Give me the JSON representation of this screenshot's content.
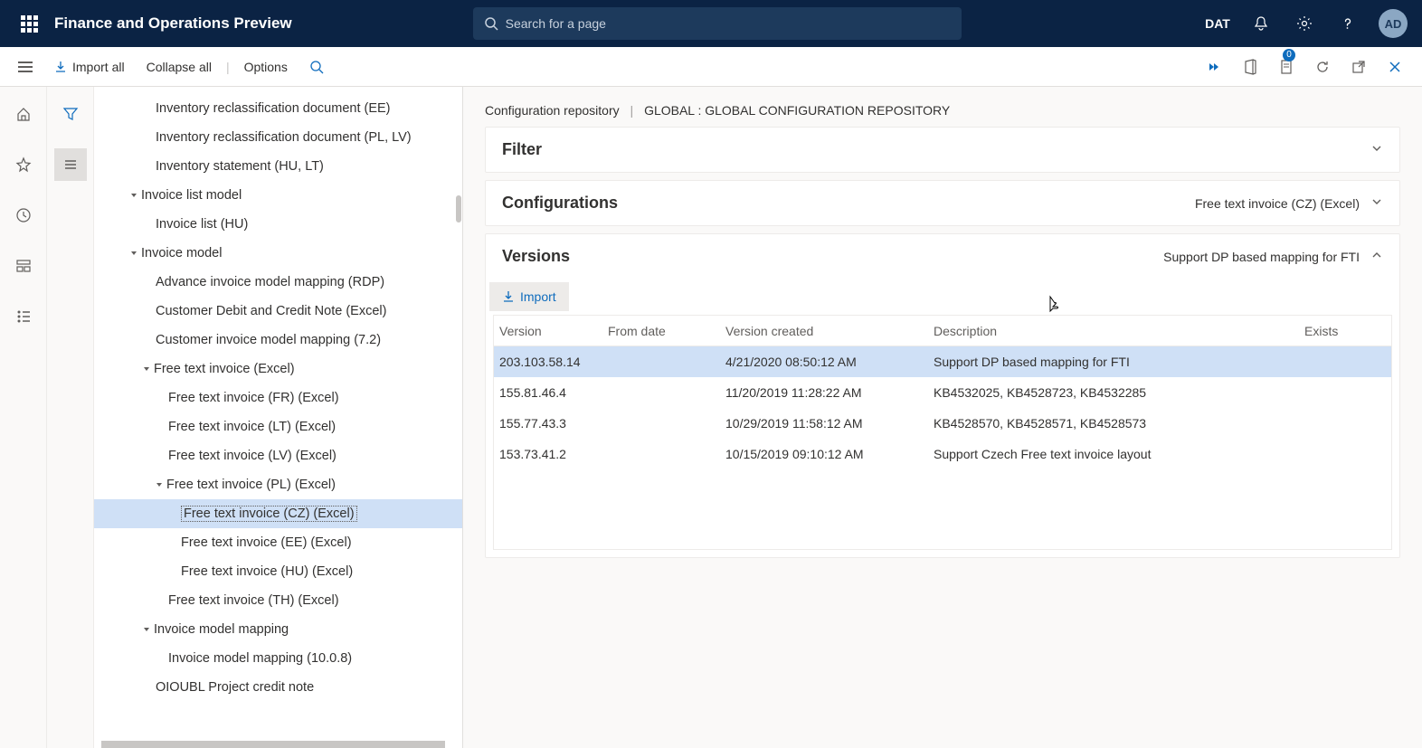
{
  "header": {
    "app_title": "Finance and Operations Preview",
    "search_placeholder": "Search for a page",
    "company": "DAT",
    "avatar": "AD",
    "notif_count": "0"
  },
  "commandbar": {
    "import_all": "Import all",
    "collapse_all": "Collapse all",
    "options": "Options"
  },
  "tree": [
    {
      "indent": 3,
      "caret": "",
      "label": "Inventory reclassification document (EE)"
    },
    {
      "indent": 3,
      "caret": "",
      "label": "Inventory reclassification document (PL, LV)"
    },
    {
      "indent": 3,
      "caret": "",
      "label": "Inventory statement (HU, LT)"
    },
    {
      "indent": 2,
      "caret": "▲",
      "label": "Invoice list model"
    },
    {
      "indent": 3,
      "caret": "",
      "label": "Invoice list (HU)"
    },
    {
      "indent": 2,
      "caret": "▲",
      "label": "Invoice model"
    },
    {
      "indent": 3,
      "caret": "",
      "label": "Advance invoice model mapping (RDP)"
    },
    {
      "indent": 3,
      "caret": "",
      "label": "Customer Debit and Credit Note (Excel)"
    },
    {
      "indent": 3,
      "caret": "",
      "label": "Customer invoice model mapping (7.2)"
    },
    {
      "indent": 3,
      "caret": "▲",
      "label": "Free text invoice (Excel)"
    },
    {
      "indent": 4,
      "caret": "",
      "label": "Free text invoice (FR) (Excel)"
    },
    {
      "indent": 4,
      "caret": "",
      "label": "Free text invoice (LT) (Excel)"
    },
    {
      "indent": 4,
      "caret": "",
      "label": "Free text invoice (LV) (Excel)"
    },
    {
      "indent": 4,
      "caret": "▲",
      "label": "Free text invoice (PL) (Excel)"
    },
    {
      "indent": 5,
      "caret": "",
      "label": "Free text invoice (CZ) (Excel)",
      "selected": true
    },
    {
      "indent": 5,
      "caret": "",
      "label": "Free text invoice (EE) (Excel)"
    },
    {
      "indent": 5,
      "caret": "",
      "label": "Free text invoice (HU) (Excel)"
    },
    {
      "indent": 4,
      "caret": "",
      "label": "Free text invoice (TH) (Excel)"
    },
    {
      "indent": 3,
      "caret": "▲",
      "label": "Invoice model mapping"
    },
    {
      "indent": 4,
      "caret": "",
      "label": "Invoice model mapping (10.0.8)"
    },
    {
      "indent": 3,
      "caret": "",
      "label": "OIOUBL Project credit note"
    }
  ],
  "breadcrumb": {
    "a": "Configuration repository",
    "b": "GLOBAL : GLOBAL CONFIGURATION REPOSITORY"
  },
  "cards": {
    "filter_title": "Filter",
    "config_title": "Configurations",
    "config_sub": "Free text invoice (CZ) (Excel)",
    "versions_title": "Versions",
    "versions_sub": "Support DP based mapping for FTI"
  },
  "import_btn": "Import",
  "grid": {
    "headers": {
      "version": "Version",
      "from": "From date",
      "created": "Version created",
      "desc": "Description",
      "exists": "Exists"
    },
    "rows": [
      {
        "version": "203.103.58.14",
        "from": "",
        "created": "4/21/2020 08:50:12 AM",
        "desc": "Support DP based mapping for FTI",
        "exists": "",
        "sel": true
      },
      {
        "version": "155.81.46.4",
        "from": "",
        "created": "11/20/2019 11:28:22 AM",
        "desc": "KB4532025, KB4528723, KB4532285",
        "exists": ""
      },
      {
        "version": "155.77.43.3",
        "from": "",
        "created": "10/29/2019 11:58:12 AM",
        "desc": "KB4528570, KB4528571, KB4528573",
        "exists": ""
      },
      {
        "version": "153.73.41.2",
        "from": "",
        "created": "10/15/2019 09:10:12 AM",
        "desc": "Support Czech Free text invoice layout",
        "exists": ""
      }
    ]
  }
}
